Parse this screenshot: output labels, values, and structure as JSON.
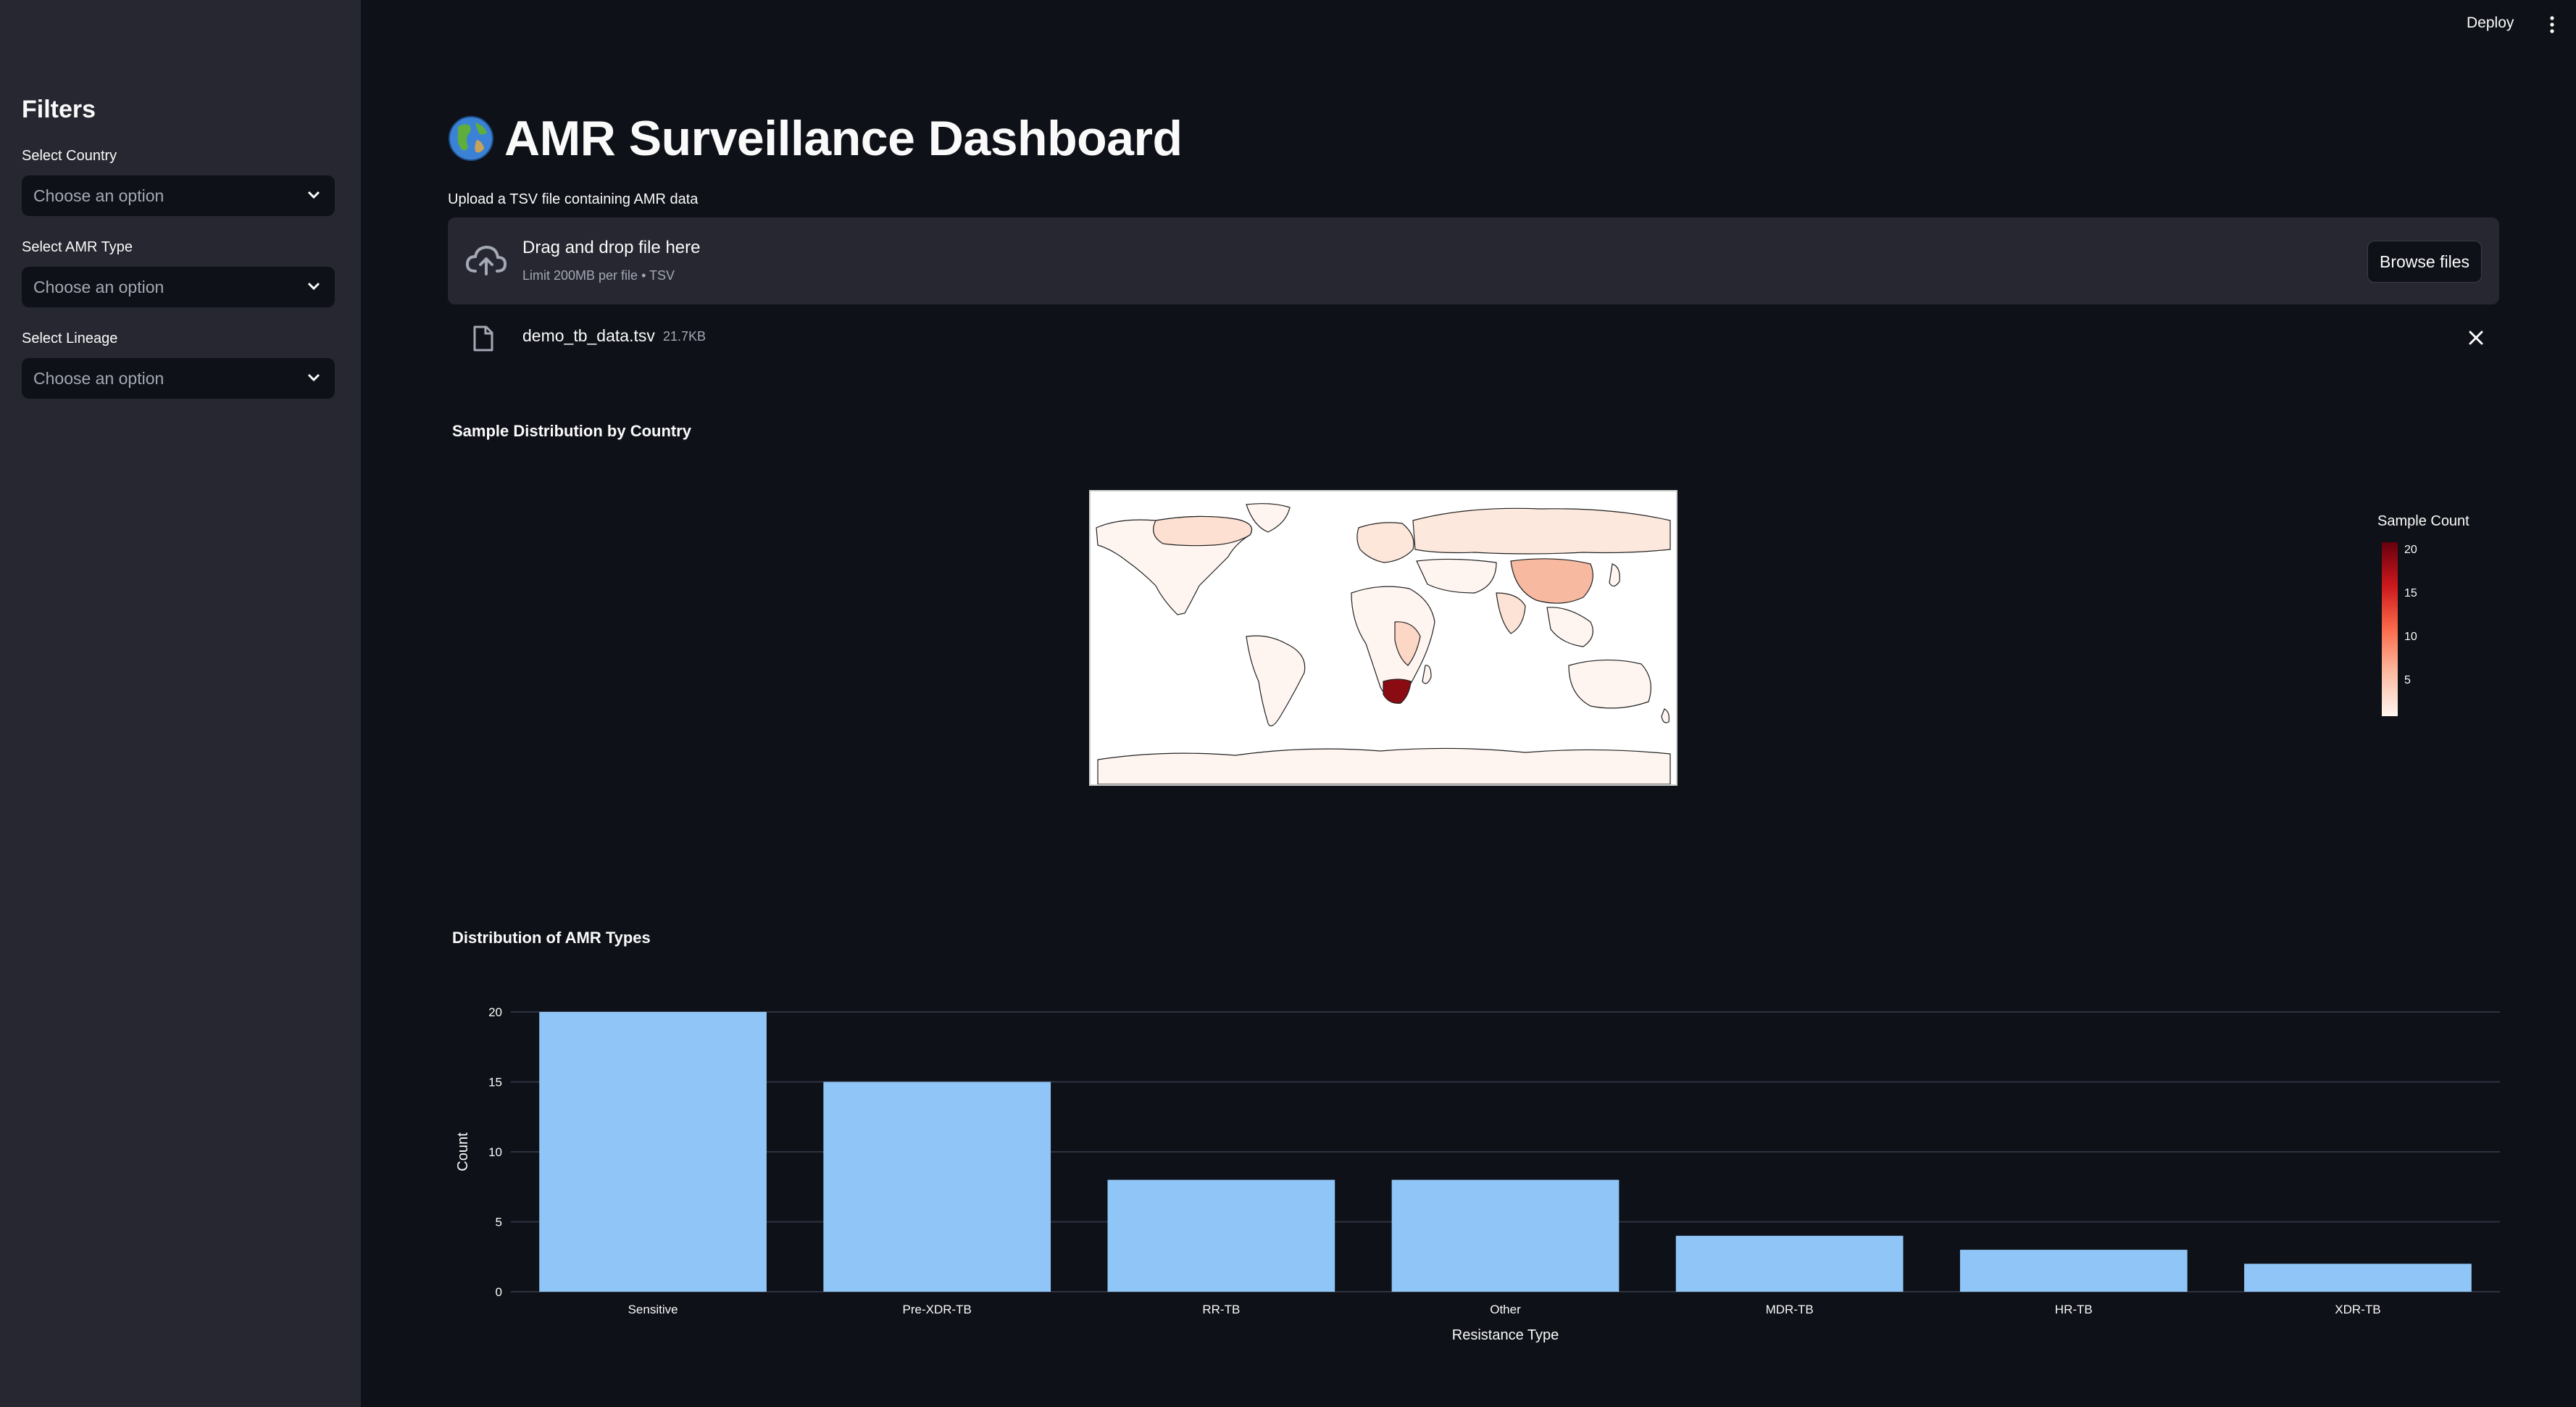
{
  "sidebar": {
    "title": "Filters",
    "filters": [
      {
        "label": "Select Country",
        "placeholder": "Choose an option"
      },
      {
        "label": "Select AMR Type",
        "placeholder": "Choose an option"
      },
      {
        "label": "Select Lineage",
        "placeholder": "Choose an option"
      }
    ]
  },
  "header": {
    "deploy_label": "Deploy"
  },
  "main": {
    "title": "AMR Surveillance Dashboard",
    "upload": {
      "label": "Upload a TSV file containing AMR data",
      "drop_text": "Drag and drop file here",
      "limit_text": "Limit 200MB per file • TSV",
      "browse_label": "Browse files"
    },
    "file": {
      "name": "demo_tb_data.tsv",
      "size": "21.7KB"
    },
    "map_section": {
      "title": "Sample Distribution by Country",
      "colorbar_title": "Sample Count",
      "colorbar_ticks": [
        "20",
        "15",
        "10",
        "5"
      ]
    },
    "bar_section": {
      "title": "Distribution of AMR Types"
    }
  },
  "colors": {
    "bar": "#90c6f7",
    "background": "#0e1117",
    "sidebar": "#262730"
  },
  "icons": [
    "chevron-down-icon",
    "kebab-menu-icon",
    "globe-icon",
    "cloud-upload-icon",
    "file-icon",
    "close-icon"
  ],
  "chart_data": {
    "type": "bar",
    "categories": [
      "Sensitive",
      "Pre-XDR-TB",
      "RR-TB",
      "Other",
      "MDR-TB",
      "HR-TB",
      "XDR-TB"
    ],
    "values": [
      20,
      15,
      8,
      8,
      4,
      3,
      2
    ],
    "xlabel": "Resistance Type",
    "ylabel": "Count",
    "ylim": [
      0,
      20
    ],
    "yticks": [
      0,
      5,
      10,
      15,
      20
    ],
    "grid": true
  }
}
